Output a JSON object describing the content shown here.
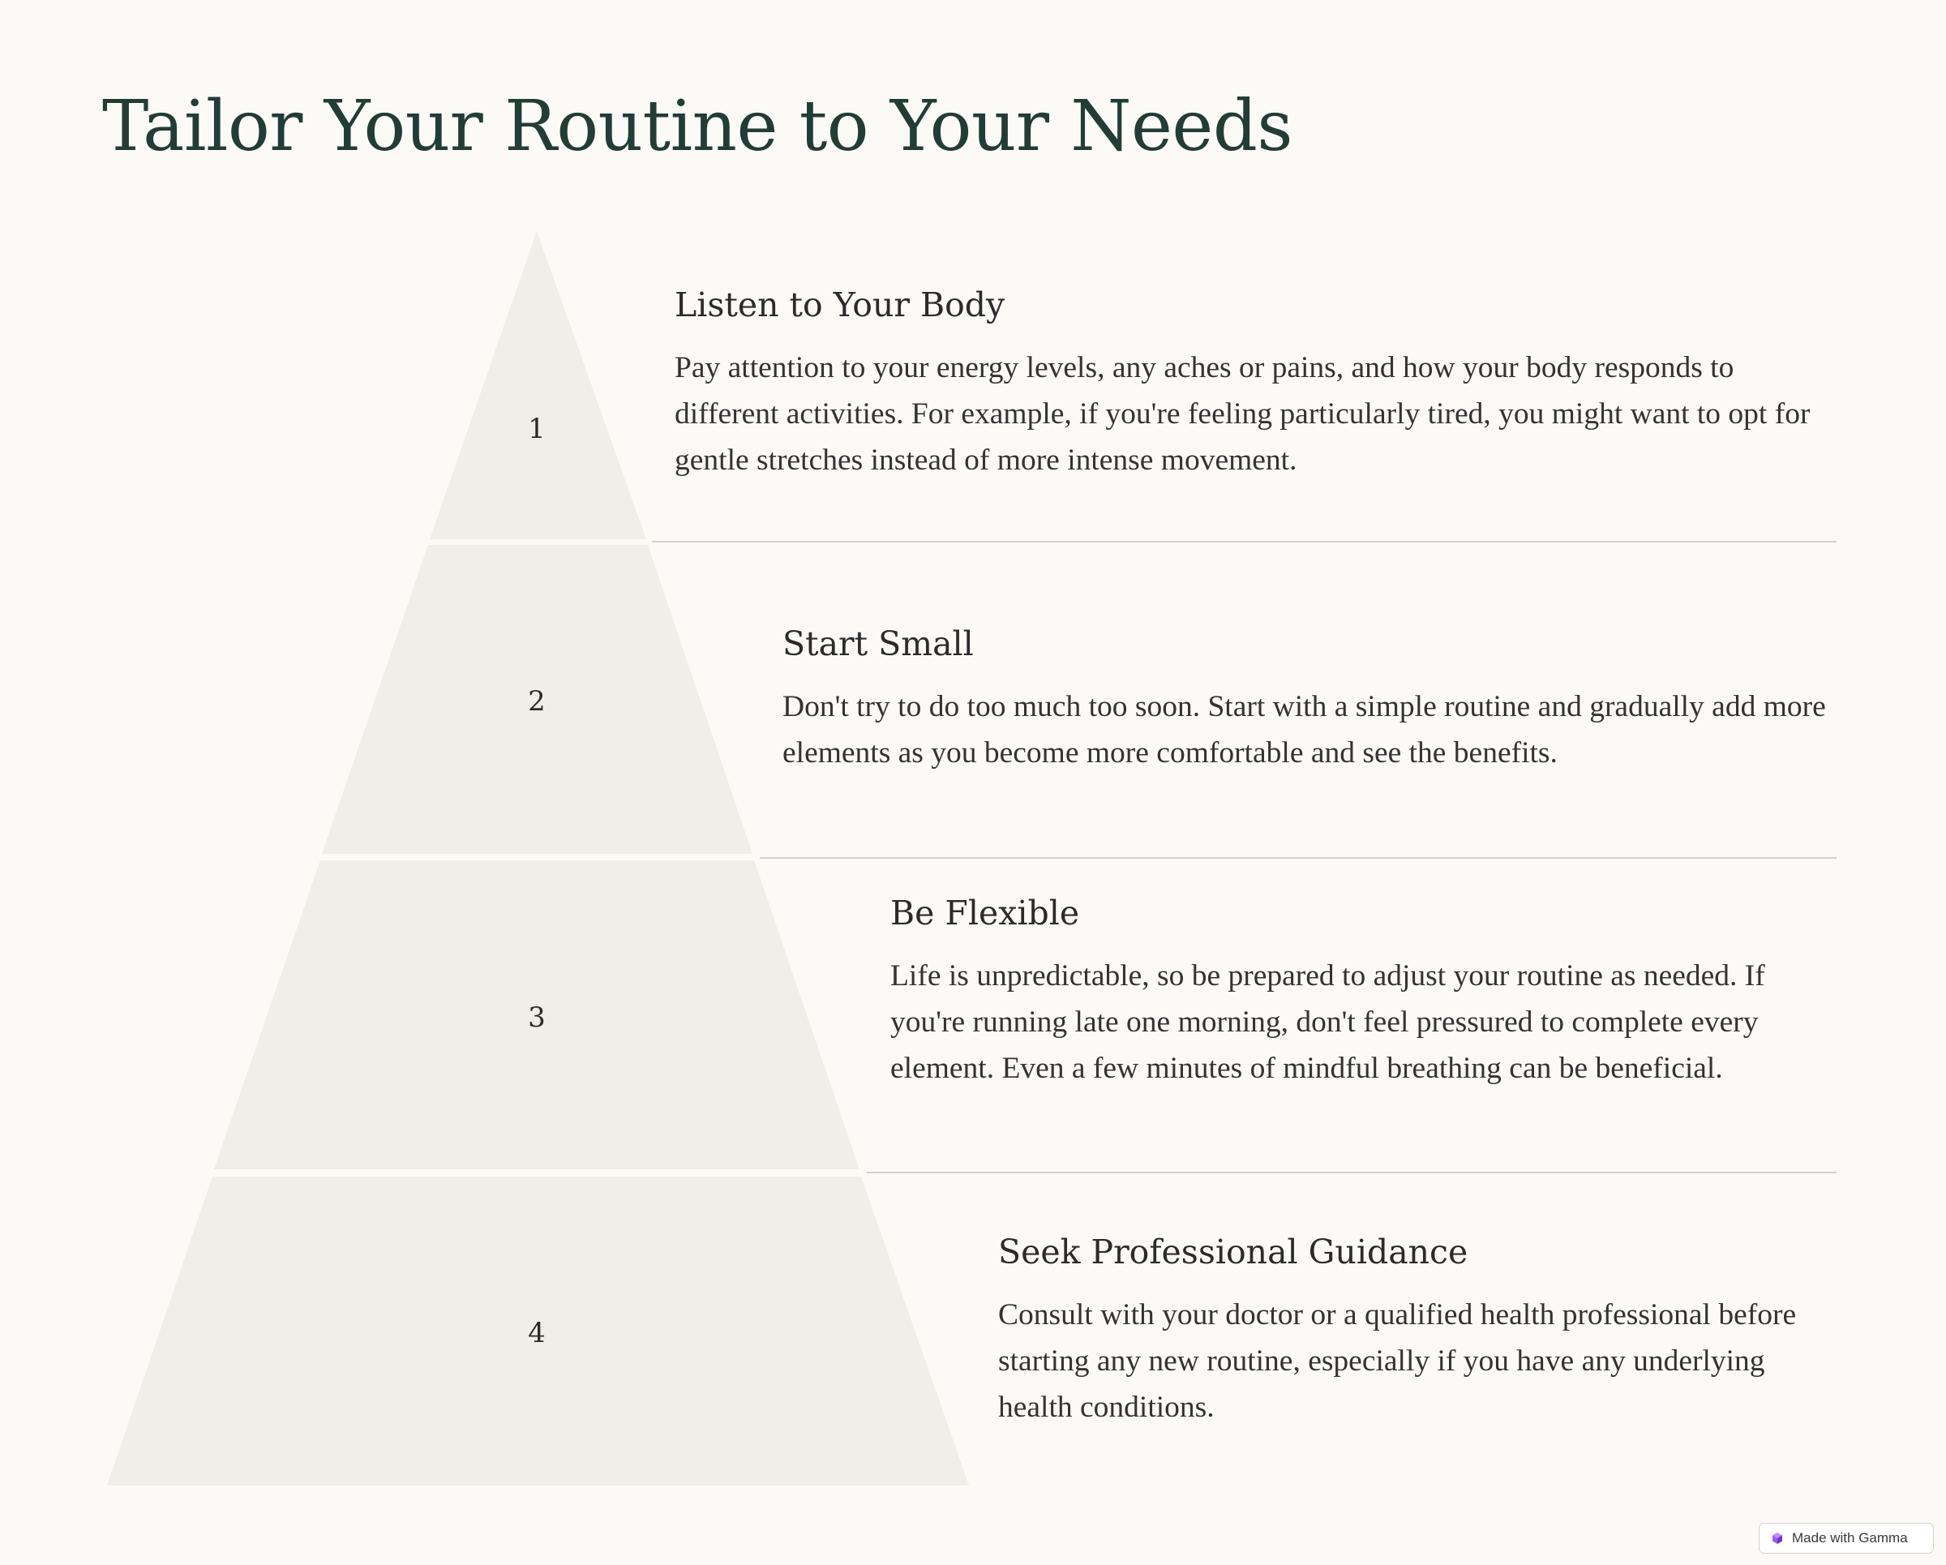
{
  "slide": {
    "title": "Tailor Your Routine to Your Needs"
  },
  "colors": {
    "background": "#fbfaf7",
    "tier_fill": "#f0eee8",
    "title": "#223d35",
    "divider": "#d3d1cc"
  },
  "tiers": [
    {
      "number": "1",
      "title": "Listen to Your Body",
      "body": "Pay attention to your energy levels, any aches or pains, and how your body responds to different activities. For example, if you're feeling particularly tired, you might want to opt for gentle stretches instead of more intense movement."
    },
    {
      "number": "2",
      "title": "Start Small",
      "body": "Don't try to do too much too soon. Start with a simple routine and gradually add more elements as you become more comfortable and see the benefits."
    },
    {
      "number": "3",
      "title": "Be Flexible",
      "body": "Life is unpredictable, so be prepared to adjust your routine as needed. If you're running late one morning, don't feel pressured to complete every element. Even a few minutes of mindful breathing can be beneficial."
    },
    {
      "number": "4",
      "title": "Seek Professional Guidance",
      "body": "Consult with your doctor or a qualified health professional before starting any new routine, especially if you have any underlying health conditions."
    }
  ],
  "badge": {
    "label": "Made with Gamma",
    "icon": "gamma-logo-icon"
  }
}
